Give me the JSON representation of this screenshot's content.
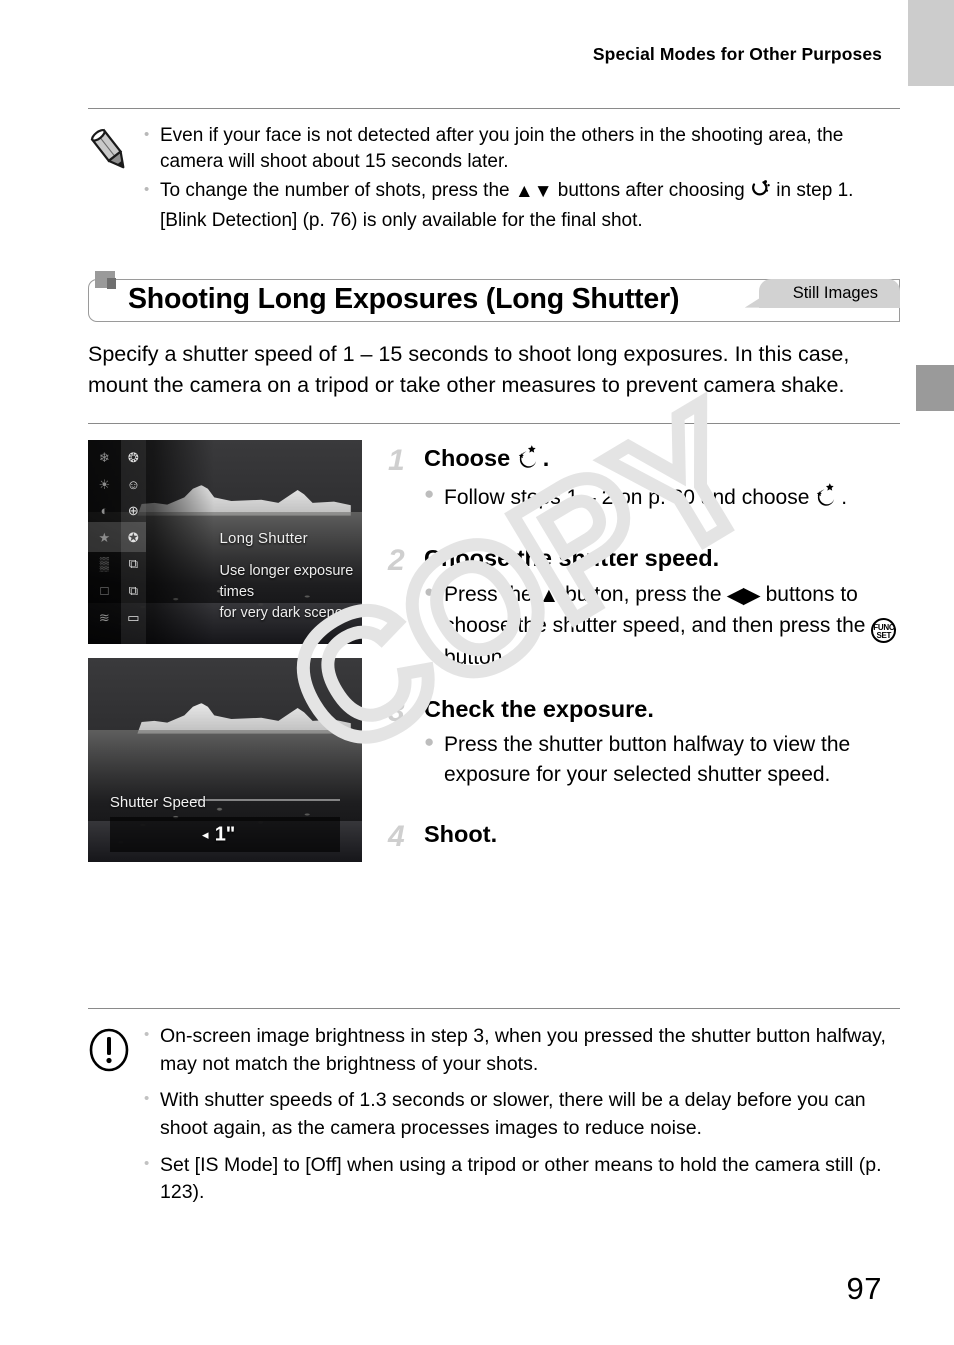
{
  "header": {
    "running_title": "Special Modes for Other Purposes"
  },
  "top_note": {
    "icon": "pencil-note-icon",
    "items": [
      "Even if your face is not detected after you join the others in the shooting area, the camera will shoot about 15 seconds later.",
      "To change the number of shots, press the ▲▼ buttons after choosing ⁙ in step 1. [Blink Detection] (p. 76) is only available for the final shot."
    ],
    "item2_pre": "To change the number of shots, press the ",
    "item2_mid": " buttons after choosing ",
    "item2_post": " in step 1. [Blink Detection] (p. 76) is only available for the final shot."
  },
  "section": {
    "tag": "Still Images",
    "title": "Shooting Long Exposures (Long Shutter)",
    "intro": "Specify a shutter speed of 1 – 15 seconds to shoot long exposures. In this case, mount the camera on a tripod or take other measures to prevent camera shake."
  },
  "shots": [
    {
      "name": "long-shutter-menu-screen",
      "mode_name": "Long Shutter",
      "desc_line1": "Use longer exposure times",
      "desc_line2": "for very dark scenes",
      "icons_left": [
        "❄",
        "☀",
        "◐",
        "★",
        "▒",
        "□",
        "≋"
      ],
      "icons_right": [
        "⁂",
        "☺",
        "⊕",
        "✪",
        "⧉",
        "⧉",
        "▭"
      ]
    },
    {
      "name": "shutter-speed-screen",
      "label": "Shutter Speed",
      "value": "1\"",
      "arrow": "◂"
    }
  ],
  "steps": [
    {
      "num": "1",
      "title_pre": "Choose ",
      "title_post": ".",
      "bullets_pre": [
        "Follow steps 1 – 2 on p. 80 and choose "
      ],
      "bullets_post": [
        "."
      ]
    },
    {
      "num": "2",
      "title": "Choose the shutter speed.",
      "text_a": "Press the ",
      "text_b": " button, press the ",
      "text_c": " buttons to choose the shutter speed, and then press the ",
      "text_d": " button."
    },
    {
      "num": "3",
      "title": "Check the exposure.",
      "bullet": "Press the shutter button halfway to view the exposure for your selected shutter speed."
    },
    {
      "num": "4",
      "title": "Shoot."
    }
  ],
  "bottom_caution": {
    "icon": "exclamation-caution-icon",
    "items": [
      "On-screen image brightness in step 3, when you pressed the shutter button halfway, may not match the brightness of your shots.",
      "With shutter speeds of 1.3 seconds or slower, there will be a delay before you can shoot again, as the camera processes images to reduce noise.",
      "Set [IS Mode] to [Off] when using a tripod or other means to hold the camera still (p. 123)."
    ]
  },
  "footer": {
    "page_number": "97"
  },
  "watermark": {
    "text": "COPY"
  },
  "glyphs": {
    "up_down": "▲▼",
    "up": "▲",
    "left_right": "◀▶",
    "bullet": "●",
    "note_bullet": "•",
    "func_set_top": "FUNC.",
    "func_set_bottom": "SET"
  },
  "colors": {
    "tab_light": "#cccccc",
    "tab_dark": "#9a9a9a",
    "still_images_tag_bg": "#d2d2d2",
    "rule": "#8a8a8a",
    "step_number": "#cfcfcf",
    "bullet": "#bdbdbd",
    "watermark": "#e6e6e6"
  }
}
